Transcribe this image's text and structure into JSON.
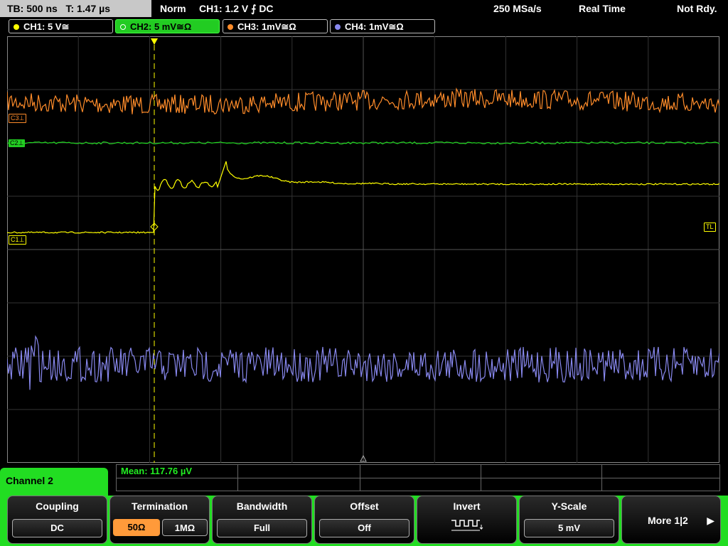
{
  "header": {
    "timebase": "TB: 500 ns",
    "trigger_time": "T: 1.47 µs",
    "mode": "Norm",
    "trigger_setting": "CH1: 1.2 V ⨍ DC",
    "sample_rate": "250 MSa/s",
    "acq_mode": "Real Time",
    "state": "Not Rdy."
  },
  "channels": [
    {
      "label": "CH1: 5 V≅",
      "color": "#ffff00",
      "active": false
    },
    {
      "label": "CH2: 5 mV≅Ω",
      "color": "#22cc22",
      "active": true
    },
    {
      "label": "CH3: 1mV≅Ω",
      "color": "#ff8c2a",
      "active": false
    },
    {
      "label": "CH4: 1mV≅Ω",
      "color": "#8888ee",
      "active": false
    }
  ],
  "markers": {
    "c3": "C3⊥",
    "c2": "C2⊥",
    "c1": "C1⊥",
    "tl": "TL",
    "trigger": "T"
  },
  "measurement": {
    "text": "Mean: 117.76 µV"
  },
  "menu": {
    "channel_title": "Channel 2",
    "softkeys": {
      "coupling": {
        "title": "Coupling",
        "value": "DC"
      },
      "termination": {
        "title": "Termination",
        "value_a": "50Ω",
        "value_b": "1MΩ"
      },
      "bandwidth": {
        "title": "Bandwidth",
        "value": "Full"
      },
      "offset": {
        "title": "Offset",
        "value": "Off"
      },
      "invert": {
        "title": "Invert",
        "icon": "square-wave-icon"
      },
      "yscale": {
        "title": "Y-Scale",
        "value": "5 mV"
      },
      "more": {
        "label": "More 1|2",
        "icon": "play-right-icon"
      }
    }
  }
}
